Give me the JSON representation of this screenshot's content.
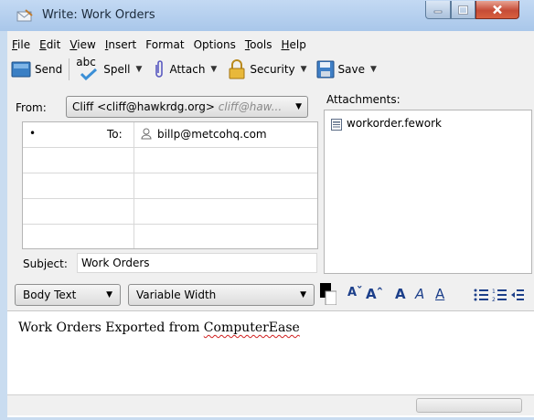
{
  "window": {
    "title": "Write: Work Orders"
  },
  "menu": [
    {
      "u": "F",
      "rest": "ile"
    },
    {
      "u": "E",
      "rest": "dit"
    },
    {
      "u": "V",
      "rest": "iew"
    },
    {
      "u": "I",
      "rest": "nsert"
    },
    {
      "u": "",
      "rest": "Format"
    },
    {
      "u": "",
      "rest": "Options"
    },
    {
      "u": "T",
      "rest": "ools"
    },
    {
      "u": "H",
      "rest": "elp"
    }
  ],
  "toolbar": {
    "send": "Send",
    "spell_prefix": "abc",
    "spell": "Spell",
    "attach": "Attach",
    "security": "Security",
    "save": "Save"
  },
  "compose": {
    "from_label": "From:",
    "from_value": "Cliff <cliff@hawkrdg.org>",
    "from_hint": "cliff@haw...",
    "row_type": "•",
    "to_label": "To:",
    "to_value": "billp@metcohq.com",
    "subject_label": "Subject:",
    "subject_value": "Work Orders",
    "attachments_label": "Attachments:",
    "attachment_file": "workorder.fework"
  },
  "format": {
    "paragraph": "Body Text",
    "font": "Variable Width",
    "btn_smaller": "Aˇ",
    "btn_larger": "Aˆ",
    "btn_bold": "A",
    "btn_italic": "A",
    "btn_underline": "A",
    "text_color": "#000000"
  },
  "body": {
    "text_before": "Work Orders Exported from ",
    "text_misspelled": "ComputerEase"
  }
}
